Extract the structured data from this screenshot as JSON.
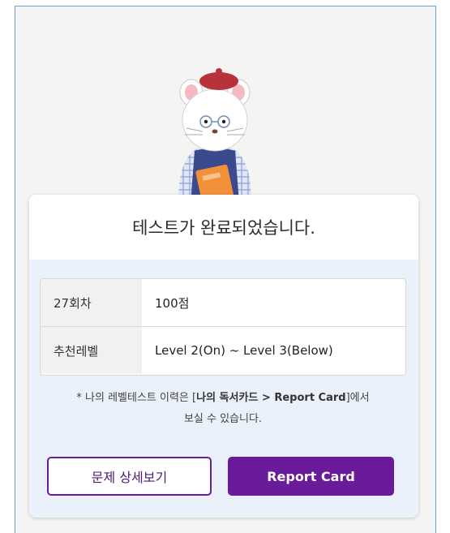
{
  "colors": {
    "accent": "#6a1b9a",
    "card_bg": "#eaf1fa",
    "page_bg": "#f4f4f2",
    "frame_border": "#6aa0d8"
  },
  "mascot": {
    "icon": "cat-librarian-mascot-icon"
  },
  "result_card": {
    "title": "테스트가 완료되었습니다.",
    "rows": [
      {
        "label": "27회차",
        "value": "100점"
      },
      {
        "label": "추천레벨",
        "value": "Level 2(On) ~ Level 3(Below)"
      }
    ],
    "note": {
      "prefix": "* 나의 레벨테스트 이력은 ",
      "bracket_open": "[",
      "link": "나의 독서카드 > Report Card",
      "bracket_close": "]",
      "suffix": "에서",
      "line2": "보실 수 있습니다."
    }
  },
  "buttons": {
    "detail_label": "문제 상세보기",
    "report_label": "Report Card"
  }
}
